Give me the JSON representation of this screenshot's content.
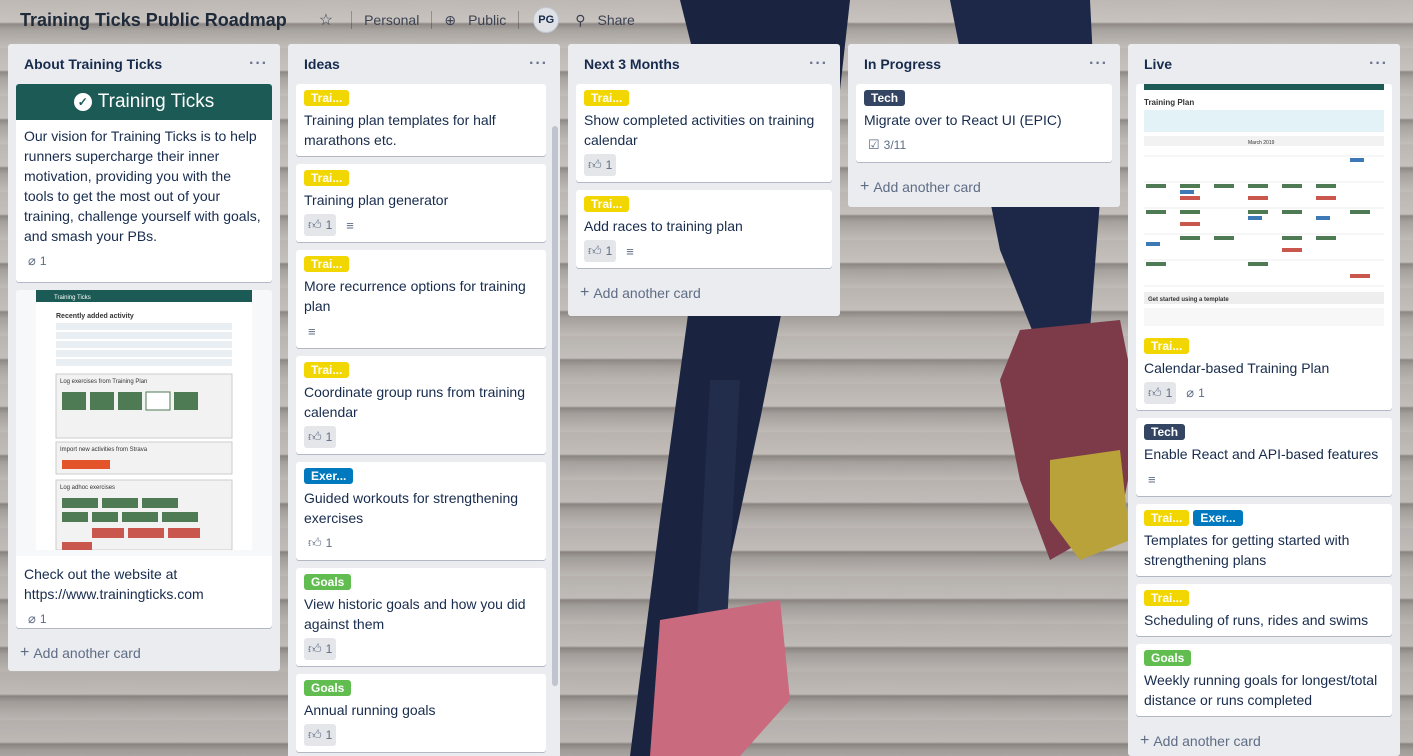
{
  "topbar": {
    "title": "Training Ticks Public Roadmap",
    "personal": "Personal",
    "public": "Public",
    "avatar": "PG",
    "share": "Share"
  },
  "lists": [
    {
      "title": "About Training Ticks",
      "hero": "Training Ticks",
      "cards": [
        {
          "text": "Our vision for Training Ticks is to help runners supercharge their inner motivation, providing you with the tools to get the most out of your training, challenge yourself with goals, and smash your PBs.",
          "attachments": "1"
        },
        {
          "text": "Check out the website at https://www.trainingticks.com",
          "attachments": "1"
        }
      ],
      "add": "Add another card"
    },
    {
      "title": "Ideas",
      "cards": [
        {
          "label": "Trai...",
          "text": "Training plan templates for half marathons etc."
        },
        {
          "label": "Trai...",
          "text": "Training plan generator",
          "votes": "1"
        },
        {
          "label": "Trai...",
          "text": "More recurrence options for training plan"
        },
        {
          "label": "Trai...",
          "text": "Coordinate group runs from training calendar",
          "votes": "1"
        },
        {
          "label": "Exer...",
          "text": "Guided workouts for strengthening exercises",
          "votes": "1"
        },
        {
          "label": "Goals",
          "text": "View historic goals and how you did against them",
          "votes": "1"
        },
        {
          "label": "Goals",
          "text": "Annual running goals",
          "votes": "1"
        }
      ]
    },
    {
      "title": "Next 3 Months",
      "cards": [
        {
          "label": "Trai...",
          "text": "Show completed activities on training calendar",
          "votes": "1"
        },
        {
          "label": "Trai...",
          "text": "Add races to training plan",
          "votes": "1"
        }
      ],
      "add": "Add another card"
    },
    {
      "title": "In Progress",
      "cards": [
        {
          "label": "Tech",
          "text": "Migrate over to React UI (EPIC)",
          "checklist": "3/11"
        }
      ],
      "add": "Add another card"
    },
    {
      "title": "Live",
      "cards": [
        {
          "label": "Trai...",
          "text": "Calendar-based Training Plan",
          "votes": "1",
          "attachments": "1"
        },
        {
          "label": "Tech",
          "text": "Enable React and API-based features"
        },
        {
          "label": "Trai...",
          "label2": "Exer...",
          "text": "Templates for getting started with strengthening plans"
        },
        {
          "label": "Trai...",
          "text": "Scheduling of runs, rides and swims"
        },
        {
          "label": "Goals",
          "text": "Weekly running goals for longest/total distance or runs completed"
        }
      ],
      "add": "Add another card"
    }
  ],
  "thumbs": {
    "brand": "Training Ticks",
    "recent_title": "Recently added activity",
    "log_plan": "Log exercises from Training Plan",
    "import": "Import new activities from Strava",
    "connect": "Connect with STRAVA",
    "log_adhoc": "Log adhoc exercises",
    "plan_title": "Training Plan",
    "plan_month": "March 2019",
    "template": "Get started using a template"
  },
  "colors": {
    "yellow": "#f2d600",
    "blue": "#0079bf",
    "green": "#61bd4f",
    "navy": "#344563",
    "teal": "#1c5b55"
  }
}
